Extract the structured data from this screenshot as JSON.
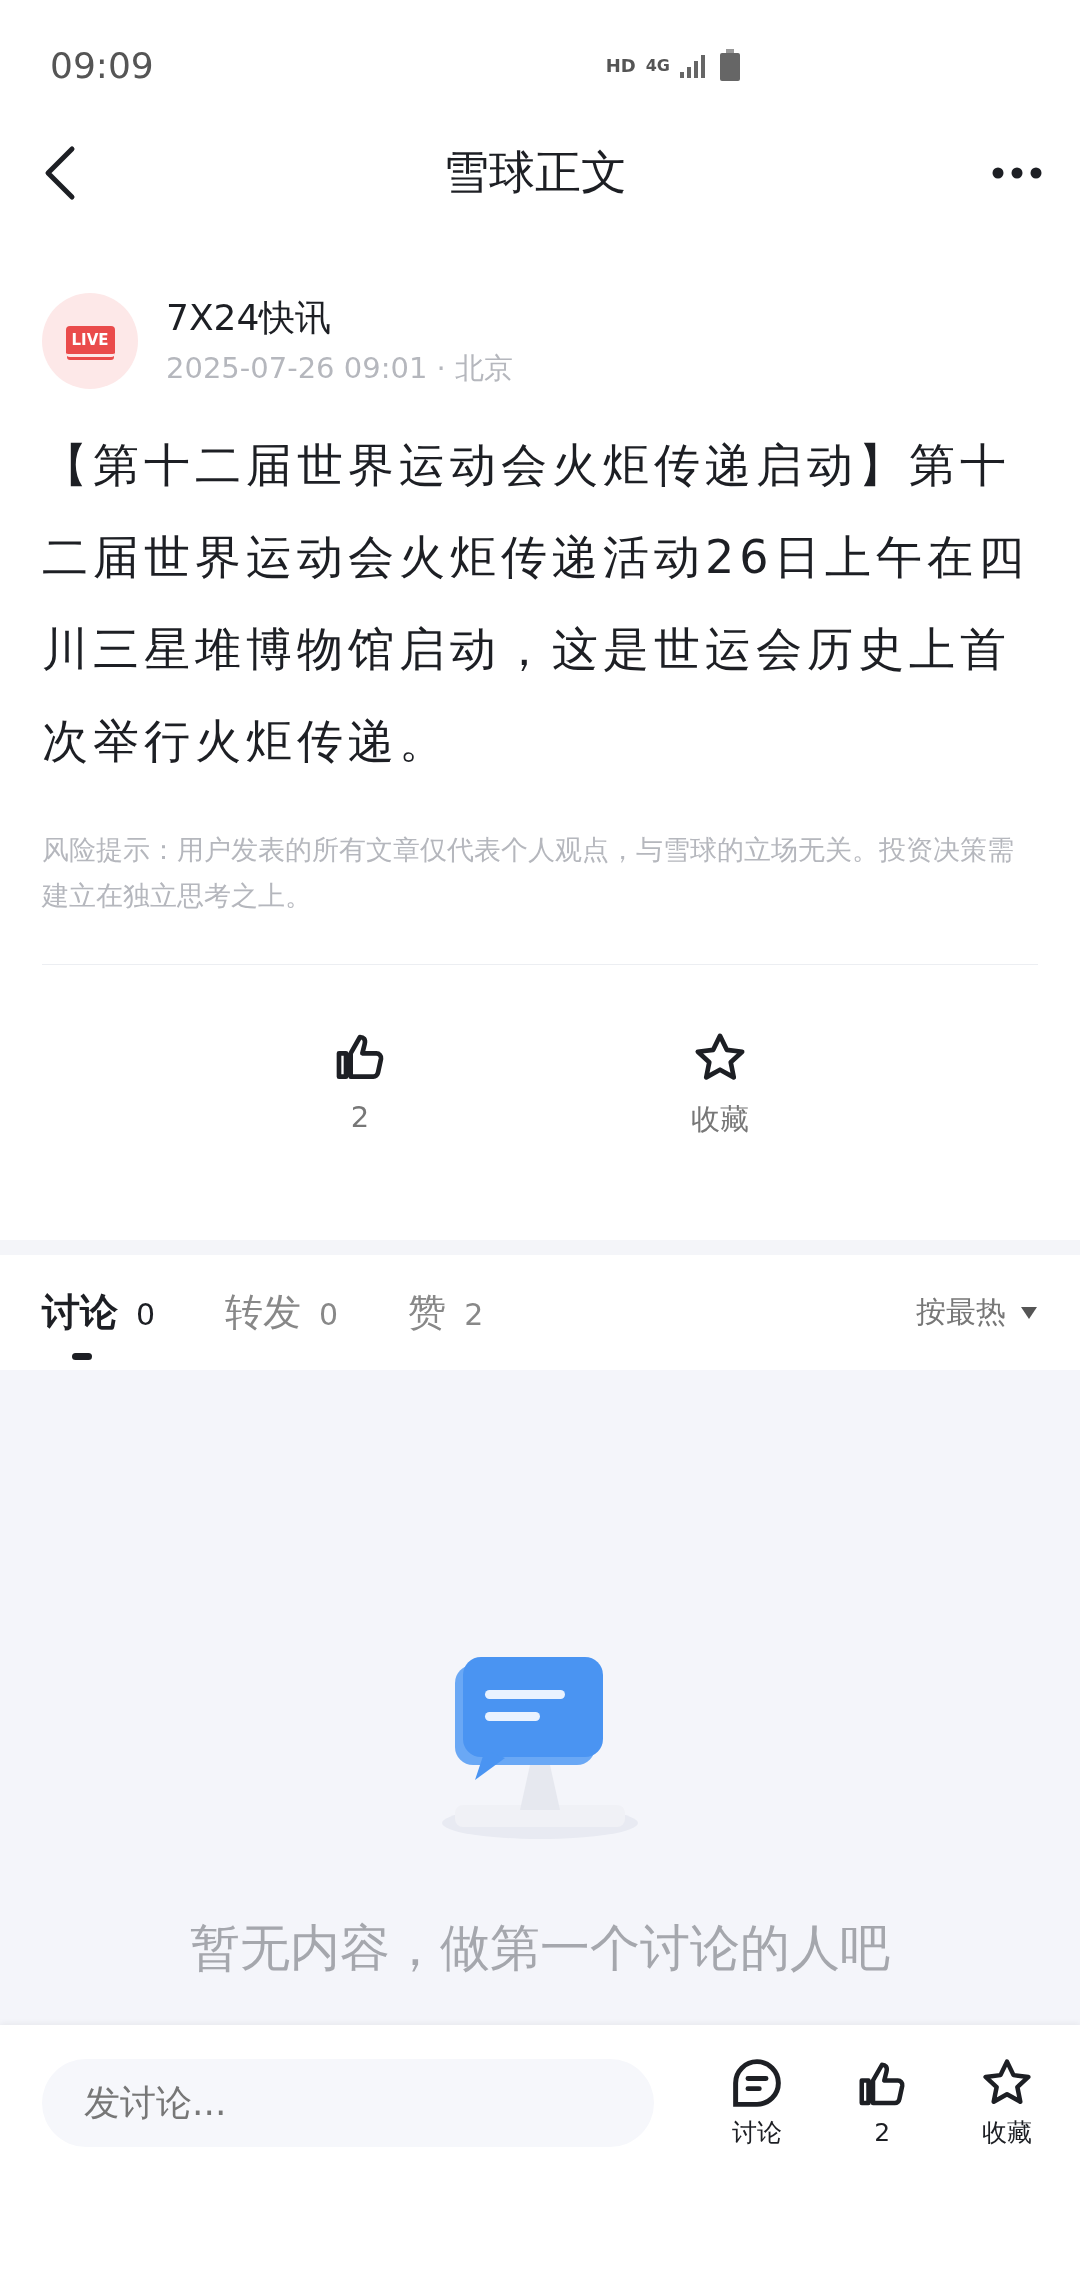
{
  "status_bar": {
    "time": "09:09",
    "network": "HD",
    "cellular": "4G"
  },
  "nav": {
    "title": "雪球正文"
  },
  "post": {
    "author": "7X24快讯",
    "meta": "2025-07-26 09:01 · 北京",
    "avatar_badge": "LIVE",
    "body": "【第十二届世界运动会火炬传递启动】第十二届世界运动会火炬传递活动26日上午在四川三星堆博物馆启动，这是世运会历史上首次举行火炬传递。",
    "risk_note": "风险提示：用户发表的所有文章仅代表个人观点，与雪球的立场无关。投资决策需建立在独立思考之上。"
  },
  "actions": [
    {
      "kind": "like",
      "label": "2"
    },
    {
      "kind": "favorite",
      "label": "收藏"
    }
  ],
  "tabs": [
    {
      "label": "讨论",
      "count": "0",
      "selected": true
    },
    {
      "label": "转发",
      "count": "0",
      "selected": false
    },
    {
      "label": "赞",
      "count": "2",
      "selected": false
    }
  ],
  "sort": {
    "label": "按最热"
  },
  "empty_state": {
    "message": "暂无内容，做第一个讨论的人吧"
  },
  "bottom_bar": {
    "placeholder": "发讨论...",
    "buttons": [
      {
        "kind": "comment",
        "label": "讨论"
      },
      {
        "kind": "like",
        "label": "2"
      },
      {
        "kind": "favorite",
        "label": "收藏"
      }
    ]
  }
}
